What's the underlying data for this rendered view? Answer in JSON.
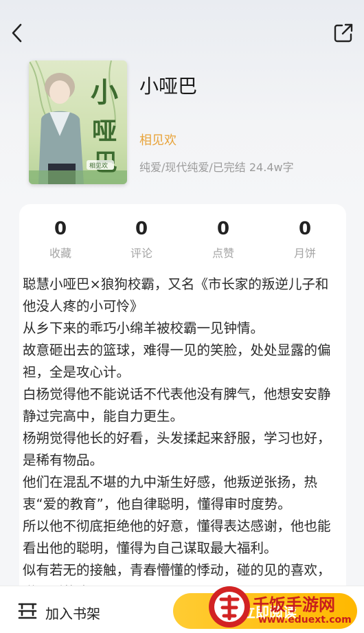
{
  "book": {
    "title": "小哑巴",
    "author": "相见欢",
    "meta": "纯爱/现代纯爱/已完结 24.4w字",
    "cover_text": "小哑巴",
    "cover_author": "相见欢"
  },
  "stats": [
    {
      "value": "0",
      "label": "收藏"
    },
    {
      "value": "0",
      "label": "评论"
    },
    {
      "value": "0",
      "label": "点赞"
    },
    {
      "value": "0",
      "label": "月饼"
    }
  ],
  "description": [
    "聪慧小哑巴×狼狗校霸，又名《市长家的叛逆儿子和他没人疼的小可怜》",
    "从乡下来的乖巧小绵羊被校霸一见钟情。",
    "故意砸出去的篮球，难得一见的笑脸，处处显露的偏袒，全是攻心计。",
    "白杨觉得他不能说话不代表他没有脾气，他想安安静静过完高中，能自力更生。",
    "杨朔觉得他长的好看，头发揉起来舒服，学习也好，是稀有物品。",
    "他们在混乱不堪的九中渐生好感，他叛逆张扬，热衷“爱的教育”，他自律聪明，懂得审时度势。",
    "所以他不彻底拒绝他的好意，懂得表达感谢，他也能看出他的聪明，懂得为自己谋取最大福利。",
    "似有若无的接触，青春懵懂的悸动，碰的见的喜欢，碰不到的痒"
  ],
  "bottom": {
    "shelf_label": "加入书架",
    "read_label": "立即阅读"
  },
  "watermark": {
    "line1": "千饭手游网",
    "line2": "www.eduext.com"
  },
  "colors": {
    "author": "#e8a33a",
    "read_button": "#ffbe1a",
    "watermark": "#c81d1d"
  }
}
